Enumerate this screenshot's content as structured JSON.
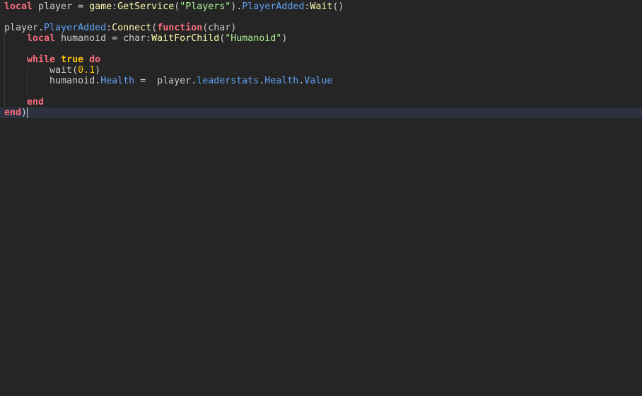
{
  "editor": {
    "colors": {
      "background": "#252525",
      "keyword": "#f86d7c",
      "function": "#fdfbac",
      "string": "#adf195",
      "property": "#61a1f1",
      "literal": "#ffc600",
      "identifier": "#cccccc",
      "current_line": "#2d3140"
    },
    "current_line": 8,
    "lines": [
      [
        [
          "local",
          "kw"
        ],
        [
          " player = ",
          "id"
        ],
        [
          "game",
          "fn"
        ],
        [
          ":",
          "id"
        ],
        [
          "GetService",
          "fn"
        ],
        [
          "(",
          "id"
        ],
        [
          "\"Players\"",
          "str"
        ],
        [
          ").",
          "id"
        ],
        [
          "PlayerAdded",
          "prop"
        ],
        [
          ":",
          "id"
        ],
        [
          "Wait",
          "fn"
        ],
        [
          "()",
          "id"
        ]
      ],
      [],
      [
        [
          "player.",
          "id"
        ],
        [
          "PlayerAdded",
          "prop"
        ],
        [
          ":",
          "id"
        ],
        [
          "Connect",
          "fn"
        ],
        [
          "(",
          "id"
        ],
        [
          "function",
          "kw"
        ],
        [
          "(char)",
          "id"
        ]
      ],
      [
        [
          "    ",
          "id"
        ],
        [
          "local",
          "kw"
        ],
        [
          " humanoid = char:",
          "id"
        ],
        [
          "WaitForChild",
          "fn"
        ],
        [
          "(",
          "id"
        ],
        [
          "\"Humanoid\"",
          "str"
        ],
        [
          ")",
          "id"
        ]
      ],
      [],
      [
        [
          "    ",
          "id"
        ],
        [
          "while",
          "kw"
        ],
        [
          " ",
          "id"
        ],
        [
          "true",
          "bool"
        ],
        [
          " ",
          "id"
        ],
        [
          "do",
          "kw"
        ]
      ],
      [
        [
          "        wait(",
          "id"
        ],
        [
          "0.1",
          "num"
        ],
        [
          ")",
          "id"
        ]
      ],
      [
        [
          "        humanoid.",
          "id"
        ],
        [
          "Health",
          "prop"
        ],
        [
          " =  player.",
          "id"
        ],
        [
          "leaderstats",
          "prop"
        ],
        [
          ".",
          "id"
        ],
        [
          "Health",
          "prop"
        ],
        [
          ".",
          "id"
        ],
        [
          "Value",
          "prop"
        ]
      ],
      [],
      [
        [
          "    ",
          "id"
        ],
        [
          "end",
          "kw"
        ]
      ],
      [
        [
          "end",
          "kw"
        ],
        [
          ")",
          "id"
        ]
      ]
    ]
  }
}
